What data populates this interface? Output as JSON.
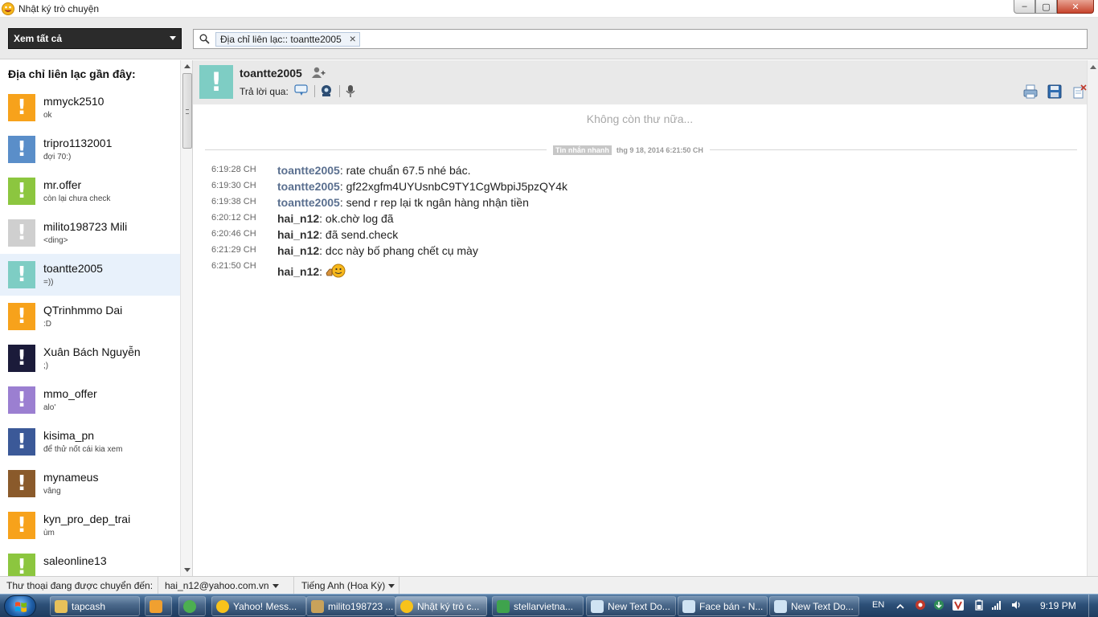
{
  "window": {
    "title": "Nhật ký trò chuyện",
    "minimize": "–",
    "maximize": "▢",
    "close": "✕"
  },
  "toolbar": {
    "view_filter": "Xem tất cả",
    "search_chip": "Địa chỉ liên lạc:: toantte2005",
    "chip_remove": "×"
  },
  "sidebar": {
    "heading": "Địa chỉ liên lạc gần đây:",
    "contacts": [
      {
        "name": "mmyck2510",
        "last_message": "ok",
        "avatar_color": "#f7a21b"
      },
      {
        "name": "tripro1132001",
        "last_message": "đợi 70:)",
        "avatar_color": "#5a8ec9"
      },
      {
        "name": "mr.offer",
        "last_message": "còn lại chưa check",
        "avatar_color": "#8cc63f"
      },
      {
        "name": "milito198723 Mili",
        "last_message": "<ding>",
        "avatar_color": "#cfcfcf"
      },
      {
        "name": "toantte2005",
        "last_message": "=))",
        "avatar_color": "#7ecdc4"
      },
      {
        "name": "QTrinhmmo Dai",
        "last_message": ":D",
        "avatar_color": "#f7a21b"
      },
      {
        "name": "Xuân Bách Nguyễn",
        "last_message": ";)",
        "avatar_color": "#1b1b3a"
      },
      {
        "name": "mmo_offer",
        "last_message": "alo'",
        "avatar_color": "#9b7fd1"
      },
      {
        "name": "kisima_pn",
        "last_message": "để thử nốt cái kia xem",
        "avatar_color": "#3b5998"
      },
      {
        "name": "mynameus",
        "last_message": "vâng",
        "avatar_color": "#8a5a2b"
      },
      {
        "name": "kyn_pro_dep_trai",
        "last_message": "ùm",
        "avatar_color": "#f7a21b"
      },
      {
        "name": "saleonline13",
        "last_message": "",
        "avatar_color": "#8cc63f"
      }
    ],
    "selected_index": 4
  },
  "conversation": {
    "contact_name": "toantte2005",
    "reply_via_label": "Trả lời qua:",
    "no_more_text": "Không còn thư nữa...",
    "session_type": "Tin nhắn nhanh",
    "session_date": "thg 9 18, 2014 6:21:50 CH",
    "messages": [
      {
        "time": "6:19:28 CH",
        "sender": "toantte2005",
        "text": ": rate chuẩn 67.5 nhé bác.",
        "from_contact": true
      },
      {
        "time": "6:19:30 CH",
        "sender": "toantte2005",
        "text": ": gf22xgfm4UYUsnbC9TY1CgWbpiJ5pzQY4k",
        "from_contact": true
      },
      {
        "time": "6:19:38 CH",
        "sender": "toantte2005",
        "text": ": send r rep lại tk ngân hàng nhận tiền",
        "from_contact": true
      },
      {
        "time": "6:20:12 CH",
        "sender": "hai_n12",
        "text": ": ok.chờ log đã",
        "from_contact": false
      },
      {
        "time": "6:20:46 CH",
        "sender": "hai_n12",
        "text": ": đã send.check",
        "from_contact": false
      },
      {
        "time": "6:21:29 CH",
        "sender": "hai_n12",
        "text": ": dcc này bố phang chết cụ mày",
        "from_contact": false
      },
      {
        "time": "6:21:50 CH",
        "sender": "hai_n12",
        "text": ":",
        "from_contact": false,
        "emoticon": "thumbs-up-emoticon"
      }
    ]
  },
  "statusbar": {
    "forward_label": "Thư thoại đang được chuyển đến:",
    "forward_account": "hai_n12@yahoo.com.vn",
    "language": "Tiếng Anh (Hoa Kỳ)"
  },
  "taskbar": {
    "tasks": [
      {
        "label": "tapcash",
        "icon_color": "#e8c15a"
      },
      {
        "label": "",
        "icon_color": "#f0a030"
      },
      {
        "label": "",
        "icon_color": "#4caf50"
      },
      {
        "label": "Yahoo! Mess...",
        "icon_color": "#f7c21b"
      },
      {
        "label": "milito198723 ...",
        "icon_color": "#c9a25a"
      },
      {
        "label": "Nhật ký trò c...",
        "icon_color": "#f7c21b"
      },
      {
        "label": "stellarvietna...",
        "icon_color": "#3fa34d"
      },
      {
        "label": "New Text Do...",
        "icon_color": "#cfe3f3"
      },
      {
        "label": "Face bán - N...",
        "icon_color": "#cfe3f3"
      },
      {
        "label": "New Text Do...",
        "icon_color": "#cfe3f3"
      }
    ],
    "language": "EN",
    "clock": "9:19 PM"
  },
  "colors": {
    "contact_sender": "#5a6f8f",
    "selected_row": "#e8f1fb",
    "header_bg": "#e9e9e9"
  }
}
